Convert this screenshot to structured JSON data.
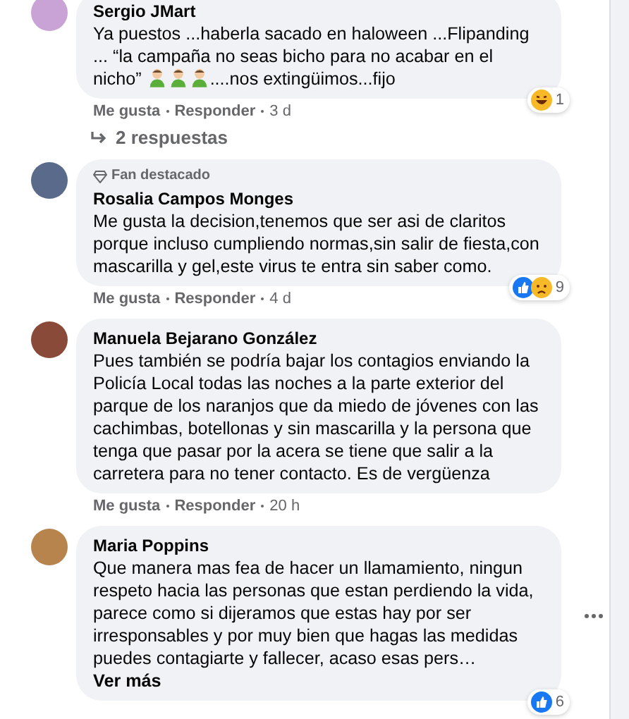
{
  "comments": [
    {
      "author": "Sergio JMart",
      "body": [
        {
          "kind": "text",
          "text": "Ya puestos ...haberla sacado en haloween ...Flipanding ... “la campaña no seas bicho para no acabar en el nicho” "
        },
        {
          "kind": "emoji"
        },
        {
          "kind": "emoji"
        },
        {
          "kind": "emoji"
        },
        {
          "kind": "text",
          "text": "....nos extingüimos...fijo"
        }
      ],
      "actions": [
        "Me gusta",
        "Responder",
        "3 d"
      ],
      "reactions": {
        "icons": [
          {
            "kind": "haha"
          }
        ],
        "count": "1"
      },
      "replies": "2 respuestas",
      "menu": false
    },
    {
      "author": "Rosalia Campos Monges",
      "badge": "Fan destacado",
      "body": [
        {
          "kind": "text",
          "text": "Me gusta la decision,tenemos que ser asi de claritos porque incluso cumpliendo normas,sin salir de fiesta,con mascarilla y gel,este virus te entra sin saber como."
        }
      ],
      "actions": [
        "Me gusta",
        "Responder",
        "4 d"
      ],
      "reactions": {
        "icons": [
          {
            "kind": "like"
          },
          {
            "kind": "sad"
          }
        ],
        "count": "9"
      },
      "menu": false
    },
    {
      "author": "Manuela Bejarano González",
      "body": [
        {
          "kind": "text",
          "text": "Pues también se podría bajar los contagios enviando la Policía Local todas las noches a la parte exterior del parque de los naranjos que da miedo de jóvenes con las cachimbas, botellonas y sin mascarilla y la persona que tenga que pasar por la acera se tiene que salir a la carretera para no tener contacto. Es de vergüenza"
        }
      ],
      "actions": [
        "Me gusta",
        "Responder",
        "20 h"
      ],
      "menu": false
    },
    {
      "author": "Maria Poppins",
      "body": [
        {
          "kind": "text",
          "text": "Que manera mas fea de hacer un llamamiento, ningun respeto hacia las personas que estan perdiendo la vida, parece como si dijeramos que estas hay por ser irresponsables y por muy bien que hagas las medidas puedes contagiarte y fallecer, acaso esas pers… "
        }
      ],
      "more": "Ver más",
      "reactions": {
        "icons": [
          {
            "kind": "like"
          }
        ],
        "count": "6"
      },
      "menu": true
    }
  ]
}
